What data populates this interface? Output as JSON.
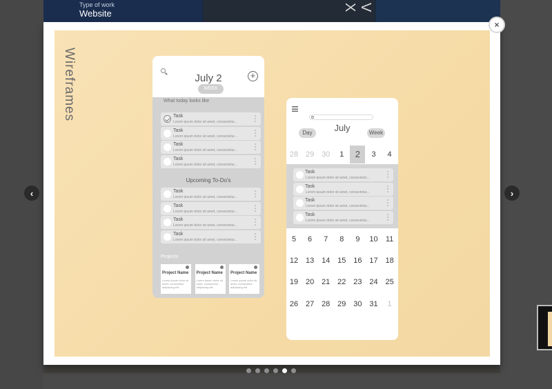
{
  "background_page": {
    "kicker": "Type of work",
    "title": "Website",
    "glyph": "V X"
  },
  "lightbox": {
    "vertical_title": "Wireframes",
    "close_symbol": "×",
    "prev_symbol": "‹",
    "next_symbol": "›",
    "dots": {
      "count": 6,
      "active_index": 4
    }
  },
  "phone1": {
    "date": "July 2",
    "week_pill": "WEEK",
    "today_label": "What today looks like",
    "plus_symbol": "+",
    "today_tasks": [
      {
        "title": "Task",
        "desc": "Lorem ipsum dolor sit amet, consectetur...",
        "checked": true
      },
      {
        "title": "Task",
        "desc": "Lorem ipsum dolor sit amet, consectetur...",
        "checked": false
      },
      {
        "title": "Task",
        "desc": "Lorem ipsum dolor sit amet, consectetur...",
        "checked": false
      },
      {
        "title": "Task",
        "desc": "Lorem ipsum dolor sit amet, consectetur...",
        "checked": false
      }
    ],
    "upcoming_label": "Upcoming To-Do's",
    "upcoming_tasks": [
      {
        "title": "Task",
        "desc": "Lorem ipsum dolor sit amet, consectetur..."
      },
      {
        "title": "Task",
        "desc": "Lorem ipsum dolor sit amet, consectetur..."
      },
      {
        "title": "Task",
        "desc": "Lorem ipsum dolor sit amet, consectetur..."
      },
      {
        "title": "Task",
        "desc": "Lorem ipsum dolor sit amet, consectetur..."
      }
    ],
    "projects_label": "Projects",
    "projects": [
      {
        "name": "Project Name",
        "desc": "Lorem ipsum dolor sit amet, consectetur adipiscing elit"
      },
      {
        "name": "Project Name",
        "desc": "Lorem ipsum dolor sit amet, consectetur adipiscing elit"
      },
      {
        "name": "Project Name",
        "desc": "Lorem ipsum dolor sit amet, consectetur adipiscing elit"
      }
    ]
  },
  "phone2": {
    "month": "July",
    "day_pill": "Day",
    "week_pill": "Week",
    "week_row_1": [
      "28",
      "29",
      "30",
      "1",
      "2",
      "3",
      "4"
    ],
    "week_row_1_dim": [
      true,
      true,
      true,
      false,
      false,
      false,
      false
    ],
    "selected_day": "2",
    "tasks": [
      {
        "title": "Task",
        "desc": "Lorem ipsum dolor sit amet, consectetur..."
      },
      {
        "title": "Task",
        "desc": "Lorem ipsum dolor sit amet, consectetur..."
      },
      {
        "title": "Task",
        "desc": "Lorem ipsum dolor sit amet, consectetur..."
      },
      {
        "title": "Task",
        "desc": "Lorem ipsum dolor sit amet, consectetur..."
      }
    ],
    "weeks": [
      [
        "5",
        "6",
        "7",
        "8",
        "9",
        "10",
        "11"
      ],
      [
        "12",
        "13",
        "14",
        "15",
        "16",
        "17",
        "18"
      ],
      [
        "19",
        "20",
        "21",
        "22",
        "23",
        "24",
        "25"
      ],
      [
        "26",
        "27",
        "28",
        "29",
        "30",
        "31",
        "1"
      ]
    ],
    "last_cell_dim": true
  }
}
